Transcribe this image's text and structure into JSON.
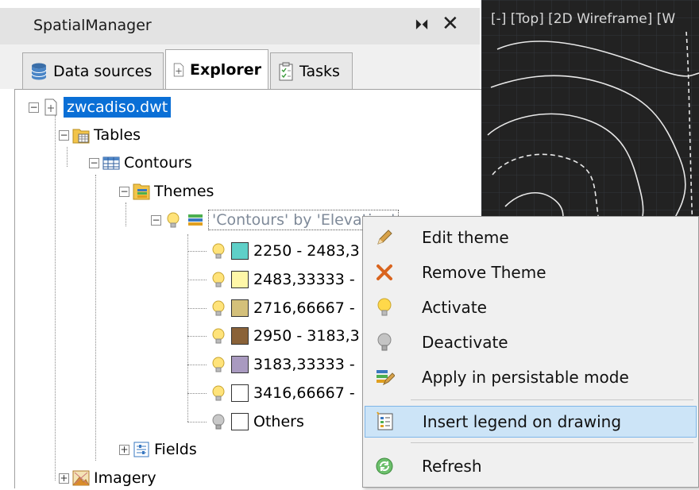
{
  "panel": {
    "title": "SpatialManager",
    "pin_glyph": "⏵⏴",
    "close_glyph": "✕"
  },
  "tabs": [
    {
      "label": "Data sources",
      "icon": "database-icon"
    },
    {
      "label": "Explorer",
      "icon": "explorer-icon",
      "active": true
    },
    {
      "label": "Tasks",
      "icon": "clipboard-icon"
    }
  ],
  "tree": {
    "root": "zwcadiso.dwt",
    "tables": "Tables",
    "contours": "Contours",
    "themes": "Themes",
    "theme_name": "'Contours' by 'Elevation'",
    "classes": [
      {
        "label": "2250 - 2483,3",
        "color": "#5fd0c8"
      },
      {
        "label": "2483,33333 -",
        "color": "#fff7a8"
      },
      {
        "label": "2716,66667 -",
        "color": "#d4c07a"
      },
      {
        "label": "2950 - 3183,3",
        "color": "#8a6238"
      },
      {
        "label": "3183,33333 -",
        "color": "#a99ac0"
      },
      {
        "label": "3416,66667 -",
        "color": "#ffffff"
      },
      {
        "label": "Others",
        "color": "#ffffff"
      }
    ],
    "fields": "Fields",
    "imagery": "Imagery"
  },
  "viewport": {
    "title": "[-] [Top] [2D Wireframe] [W"
  },
  "context_menu": [
    {
      "label": "Edit theme",
      "icon": "pencil-icon"
    },
    {
      "label": "Remove Theme",
      "icon": "remove-x-icon"
    },
    {
      "label": "Activate",
      "icon": "bulb-on-icon"
    },
    {
      "label": "Deactivate",
      "icon": "bulb-off-icon"
    },
    {
      "label": "Apply in persistable mode",
      "icon": "persist-icon"
    },
    {
      "label": "Insert legend on drawing",
      "icon": "legend-icon",
      "highlighted": true
    },
    {
      "label": "Refresh",
      "icon": "refresh-icon"
    }
  ]
}
